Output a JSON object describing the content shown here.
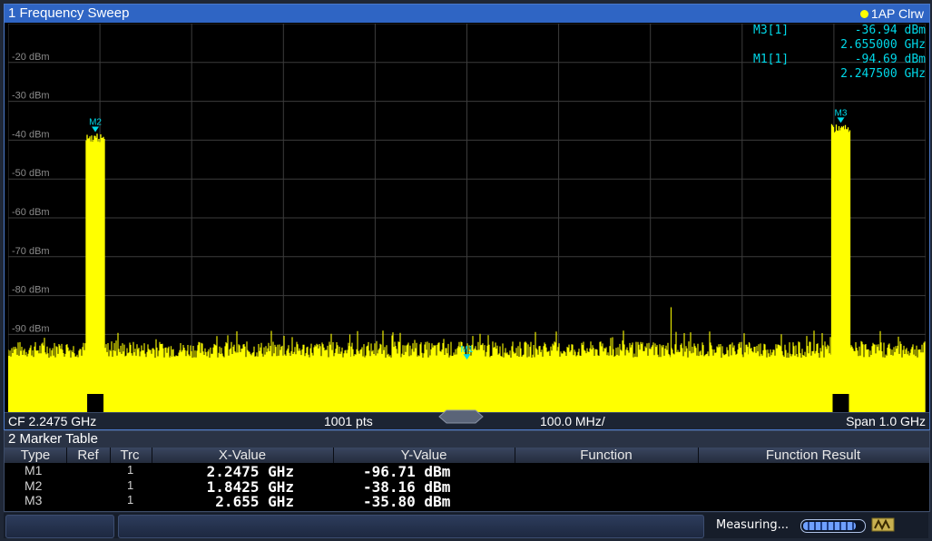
{
  "sweep": {
    "title": "1 Frequency Sweep",
    "trace_mode": "1AP Clrw",
    "marker_info": [
      {
        "label": "M3[1]",
        "level": "-36.94 dBm",
        "freq": "2.655000 GHz"
      },
      {
        "label": "M1[1]",
        "level": "-94.69 dBm",
        "freq": "2.247500 GHz"
      }
    ],
    "y_axis_labels": [
      "-20 dBm",
      "-30 dBm",
      "-40 dBm",
      "-50 dBm",
      "-60 dBm",
      "-70 dBm",
      "-80 dBm",
      "-90 dBm"
    ],
    "markers": [
      {
        "name": "M2",
        "freq_ghz": 1.8425,
        "level_dbm": -38.16
      },
      {
        "name": "M1",
        "freq_ghz": 2.2475,
        "level_dbm": -96.71
      },
      {
        "name": "M3",
        "freq_ghz": 2.655,
        "level_dbm": -35.8
      }
    ],
    "footer": {
      "center_freq": "CF 2.2475 GHz",
      "points": "1001 pts",
      "div": "100.0 MHz/",
      "span": "Span 1.0 GHz"
    }
  },
  "marker_table": {
    "title": "2 Marker Table",
    "headers": [
      "Type",
      "Ref",
      "Trc",
      "X-Value",
      "Y-Value",
      "Function",
      "Function Result"
    ],
    "rows": [
      {
        "type": "M1",
        "ref": "",
        "trc": "1",
        "x": "2.2475 GHz",
        "y": "-96.71 dBm"
      },
      {
        "type": "M2",
        "ref": "",
        "trc": "1",
        "x": "1.8425 GHz",
        "y": "-38.16 dBm"
      },
      {
        "type": "M3",
        "ref": "",
        "trc": "1",
        "x": "2.655 GHz",
        "y": "-35.80 dBm"
      }
    ]
  },
  "status": {
    "measuring": "Measuring...",
    "progress": 0.9
  },
  "colors": {
    "trace": "#ffff00",
    "marker": "#00d8e8",
    "title_bar": "#2f65c4",
    "grid": "#3c3c3c"
  }
}
